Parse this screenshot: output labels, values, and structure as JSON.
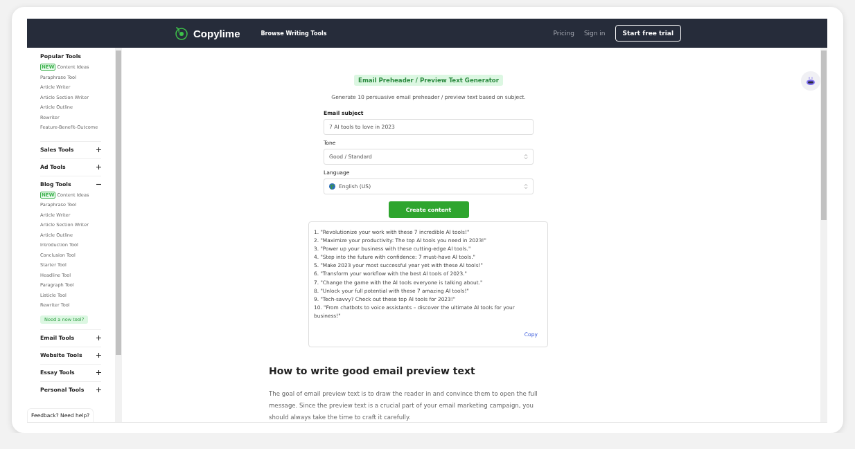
{
  "header": {
    "brand": "Copylime",
    "browse_link": "Browse Writing Tools",
    "nav_links": [
      "Pricing",
      "Sign in"
    ],
    "trial_button": "Start free trial"
  },
  "sidebar": {
    "sections": [
      {
        "title": "Popular Tools",
        "kind": "static",
        "items": [
          {
            "badge": "NEW",
            "label": "Content Ideas"
          },
          {
            "label": "Paraphrase Tool"
          },
          {
            "label": "Article Writer"
          },
          {
            "label": "Article Section Writer"
          },
          {
            "label": "Article Outline"
          },
          {
            "label": "Rewriter"
          },
          {
            "label": "Feature-Benefit-Outcome"
          }
        ]
      },
      {
        "title": "Sales Tools",
        "kind": "collapsible",
        "expanded": false
      },
      {
        "title": "Ad Tools",
        "kind": "collapsible",
        "expanded": false
      },
      {
        "title": "Blog Tools",
        "kind": "collapsible",
        "expanded": true,
        "items": [
          {
            "badge": "NEW",
            "label": "Content Ideas"
          },
          {
            "label": "Paraphrase Tool"
          },
          {
            "label": "Article Writer"
          },
          {
            "label": "Article Section Writer"
          },
          {
            "label": "Article Outline"
          },
          {
            "label": "Introduction Tool"
          },
          {
            "label": "Conclusion Tool"
          },
          {
            "label": "Starter Tool"
          },
          {
            "label": "Headline Tool"
          },
          {
            "label": "Paragraph Tool"
          },
          {
            "label": "Listicle Tool"
          },
          {
            "label": "Rewriter Tool"
          }
        ],
        "request_link": "Need a new tool?"
      },
      {
        "title": "Email Tools",
        "kind": "collapsible",
        "expanded": false
      },
      {
        "title": "Website Tools",
        "kind": "collapsible",
        "expanded": false
      },
      {
        "title": "Essay Tools",
        "kind": "collapsible",
        "expanded": false
      },
      {
        "title": "Personal Tools",
        "kind": "collapsible",
        "expanded": false
      }
    ],
    "feedback": "Feedback? Need help?"
  },
  "tool": {
    "title": "Email Preheader / Preview Text Generator",
    "description": "Generate 10 persuasive email preheader / preview text based on subject.",
    "fields": [
      {
        "kind": "text",
        "label": "Email subject",
        "value": "7 AI tools to love in 2023"
      },
      {
        "kind": "select",
        "label": "Tone",
        "value": "Good / Standard"
      },
      {
        "kind": "language",
        "label": "Language",
        "value": "English (US)"
      }
    ],
    "submit": "Create content",
    "output": {
      "lines": [
        "1. \"Revolutionize your work with these 7 incredible AI tools!\"",
        "2. \"Maximize your productivity: The top AI tools you need in 2023!\"",
        "3. \"Power up your business with these cutting-edge AI tools.\"",
        "4. \"Step into the future with confidence: 7 must-have AI tools.\"",
        "5. \"Make 2023 your most successful year yet with these AI tools!\"",
        "6. \"Transform your workflow with the best AI tools of 2023.\"",
        "7. \"Change the game with the AI tools everyone is talking about.\"",
        "8. \"Unlock your full potential with these 7 amazing AI tools!\"",
        "9. \"Tech-savvy? Check out these top AI tools for 2023!\"",
        "10. \"From chatbots to voice assistants – discover the ultimate AI tools for your business!\""
      ],
      "copy": "Copy"
    }
  },
  "article": {
    "heading": "How to write good email preview text",
    "paragraph": "The goal of email preview text is to draw the reader in and convince them to open the full message. Since the preview text is a crucial part of your email marketing campaign, you should always take the time to craft it carefully."
  }
}
